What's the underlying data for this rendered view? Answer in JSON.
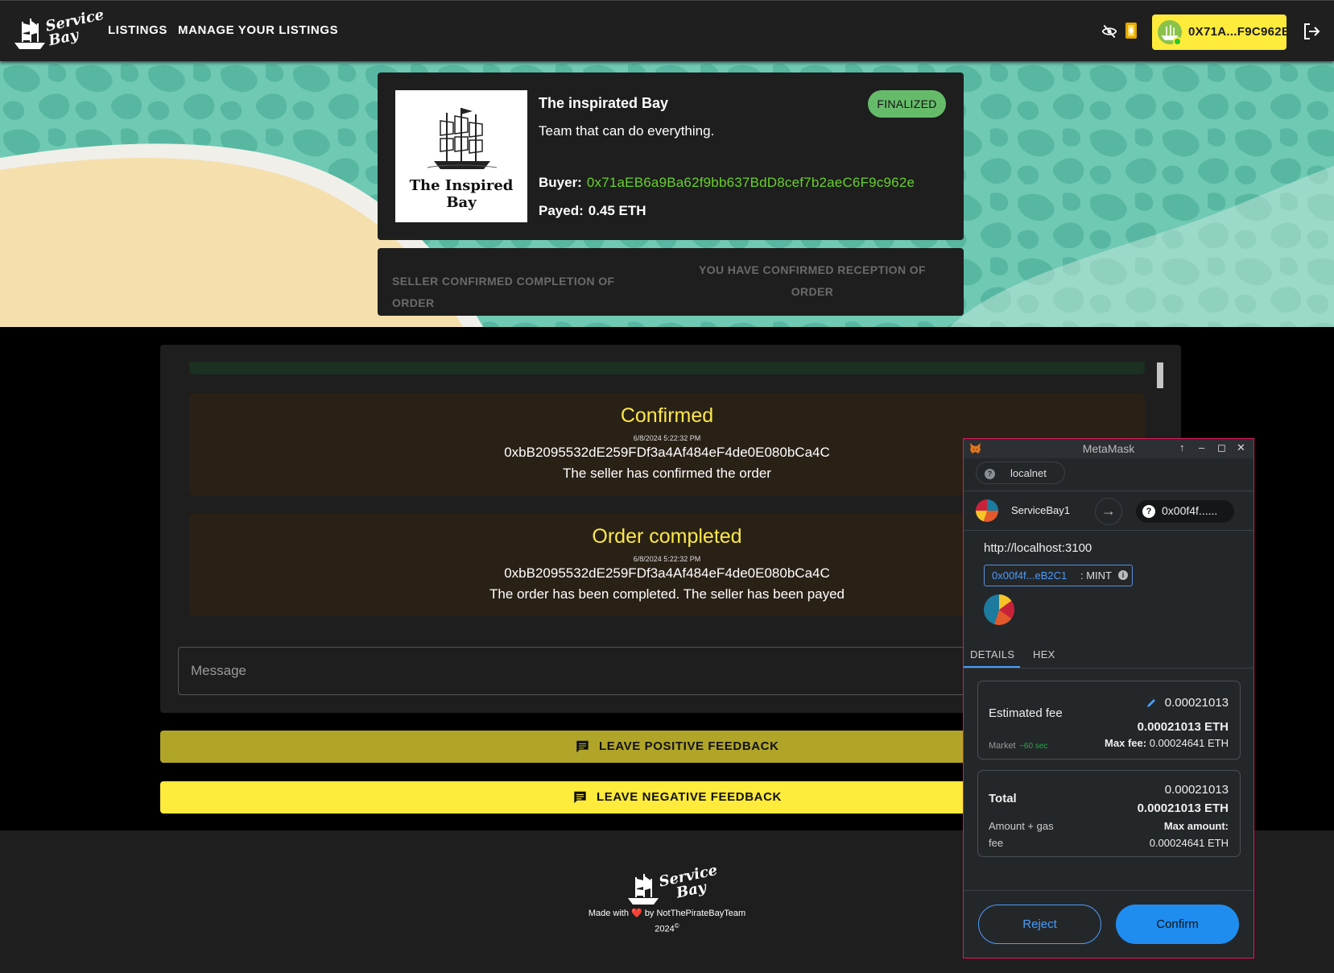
{
  "nav": {
    "logo_text": "Service Bay",
    "links": [
      "LISTINGS",
      "MANAGE YOUR LISTINGS"
    ],
    "wallet_address": "0X71A...F9C962E"
  },
  "order": {
    "image_caption": "The Inspired Bay",
    "title": "The inspirated Bay",
    "description": "Team that can do everything.",
    "status": "FINALIZED",
    "buyer_label": "Buyer:",
    "buyer_address": "0x71aEB6a9Ba62f9bb637BdD8cef7b2aeC6F9c962e",
    "payed_label": "Payed:",
    "payed_value": "0.45 ETH"
  },
  "steps": {
    "seller": "SELLER CONFIRMED COMPLETION OF ORDER",
    "buyer": "YOU HAVE CONFIRMED RECEPTION OF ORDER"
  },
  "messages": [
    {
      "title": "Confirmed",
      "time": "6/8/2024 5:22:32 PM",
      "address": "0xbB2095532dE259FDf3a4Af484eF4de0E080bCa4C",
      "text": "The seller has confirmed the order"
    },
    {
      "title": "Order completed",
      "time": "6/8/2024 5:22:32 PM",
      "address": "0xbB2095532dE259FDf3a4Af484eF4de0E080bCa4C",
      "text": "The order has been completed. The seller has been payed"
    }
  ],
  "message_input": {
    "placeholder": "Message"
  },
  "feedback": {
    "positive": "LEAVE POSITIVE FEEDBACK",
    "negative": "LEAVE NEGATIVE FEEDBACK",
    "positive_color": "#b0a528",
    "negative_color": "#ffeb3b"
  },
  "footer": {
    "logo_text": "Service Bay",
    "made_with": "Made with",
    "heart": "❤️",
    "by": "by NotThePirateBayTeam",
    "year": "2024",
    "copyright": "©"
  },
  "metamask": {
    "title": "MetaMask",
    "network": "localnet",
    "account_name": "ServiceBay1",
    "destination": "0x00f4f......",
    "origin": "http://localhost:3100",
    "contract_address": "0x00f4f...eB2C1",
    "contract_function": ": MINT",
    "tabs": [
      "DETAILS",
      "HEX"
    ],
    "estimated_fee": {
      "label": "Estimated fee",
      "value": "0.00021013",
      "value_eth": "0.00021013 ETH",
      "market": "Market",
      "market_time": "~60 sec",
      "max_fee_label": "Max fee:",
      "max_fee_value": "0.00024641 ETH"
    },
    "total": {
      "label": "Total",
      "value": "0.00021013",
      "value_eth": "0.00021013 ETH",
      "sub_label_1": "Amount + gas",
      "sub_label_2": "fee",
      "max_amount_label": "Max amount:",
      "max_amount_value": "0.00024641 ETH"
    },
    "reject": "Reject",
    "confirm": "Confirm"
  }
}
